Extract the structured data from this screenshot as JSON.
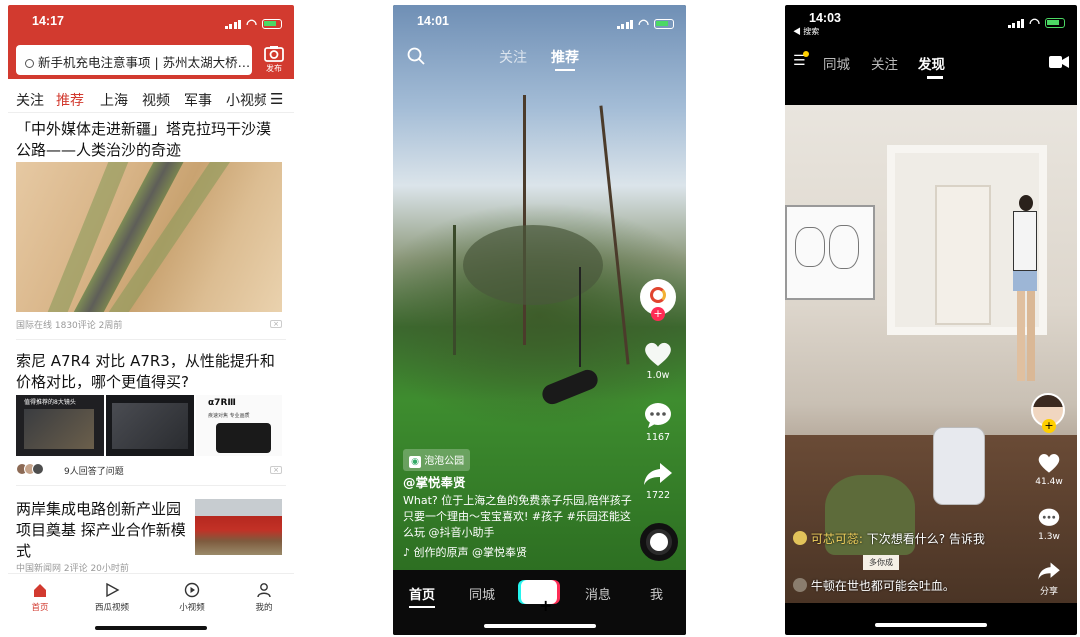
{
  "phone1": {
    "status": {
      "time": "14:17"
    },
    "search": {
      "text": "新手机充电注意事项 | 苏州太湖大桥…"
    },
    "publish_label": "发布",
    "tabs": [
      "关注",
      "推荐",
      "上海",
      "视频",
      "军事",
      "小视频"
    ],
    "active_tab": "推荐",
    "articles": [
      {
        "title": "「中外媒体走进新疆」塔克拉玛干沙漠公路——人类治沙的奇迹",
        "meta": "国际在线  1830评论  2周前"
      },
      {
        "title": "索尼 A7R4 对比 A7R3，从性能提升和价格对比，哪个更值得买?",
        "meta": "9人回答了问题",
        "thumb_texts": [
          "值得推荐的8大镜头",
          "α7RⅢ",
          "疾速对焦 专业画质"
        ]
      },
      {
        "title": "两岸集成电路创新产业园项目奠基 探产业合作新模式",
        "meta": "中国新闻网  2评论  20小时前"
      }
    ],
    "bottom_nav": [
      {
        "label": "首页",
        "icon": "home-icon"
      },
      {
        "label": "西瓜视频",
        "icon": "play-icon"
      },
      {
        "label": "小视频",
        "icon": "short-video-icon"
      },
      {
        "label": "我的",
        "icon": "profile-icon"
      }
    ],
    "accent": "#d23a2f"
  },
  "phone2": {
    "status": {
      "time": "14:01"
    },
    "top_tabs": [
      "关注",
      "推荐"
    ],
    "active_tab": "推荐",
    "likes": "1.0w",
    "comments": "1167",
    "shares": "1722",
    "location": "泡泡公园",
    "author": "@掌悦奉贤",
    "caption": "What? 位于上海之鱼的免费亲子乐园,陪伴孩子只要一个理由～宝宝喜欢! #孩子 #乐园还能这么玩 @抖音小助手",
    "music": "创作的原声  @掌悦奉贤",
    "bottom_nav": [
      "首页",
      "同城",
      "+",
      "消息",
      "我"
    ]
  },
  "phone3": {
    "status": {
      "time": "14:03",
      "back": "◀ 搜索"
    },
    "top_tabs": [
      "同城",
      "关注",
      "发现"
    ],
    "active_tab": "发现",
    "likes": "41.4w",
    "comments": "1.3w",
    "share_label": "分享",
    "comment1": {
      "user": "可芯可蕊:",
      "text": "下次想看什么? 告诉我"
    },
    "comment2": {
      "text": "牛顿在世也都可能会吐血。"
    },
    "whiteboard_text": "多你成"
  }
}
